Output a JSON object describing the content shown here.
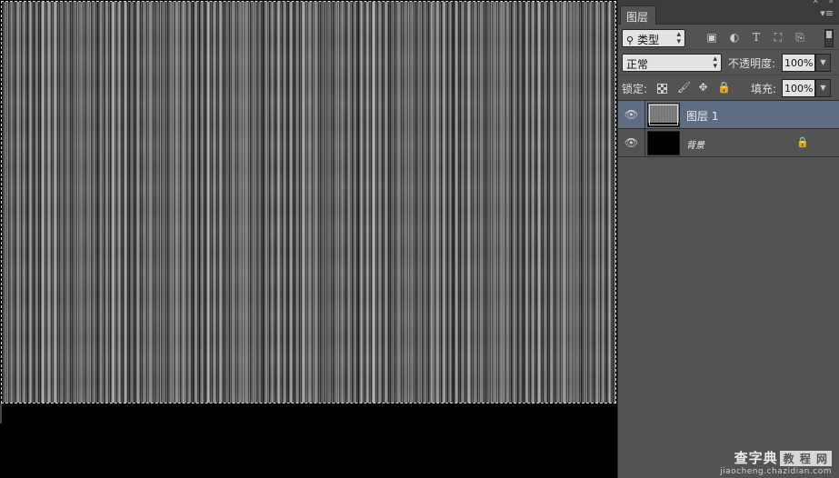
{
  "panel": {
    "tab_label": "图层",
    "filter": {
      "kind_label": "类型"
    },
    "blend": {
      "mode_label": "正常",
      "opacity_label": "不透明度:",
      "opacity_value": "100%"
    },
    "lock": {
      "label": "锁定:",
      "fill_label": "填充:",
      "fill_value": "100%"
    },
    "layers": [
      {
        "name": "图层 1",
        "visible": true,
        "selected": true,
        "locked": false
      },
      {
        "name": "背景",
        "visible": true,
        "selected": false,
        "locked": true
      }
    ]
  },
  "watermark": {
    "brand": "查字典",
    "boxed": "教 程 网",
    "url": "jiaocheng.chazidian.com"
  },
  "colors": {
    "panel_bg": "#535353",
    "selected_layer": "#5f6d83",
    "canvas_bg": "#000000"
  },
  "icons": [
    "eye-icon",
    "lock-icon",
    "search-icon",
    "image-filter-icon",
    "adjustment-filter-icon",
    "type-filter-icon",
    "shape-filter-icon",
    "smart-object-filter-icon",
    "brush-icon",
    "move-icon",
    "panel-menu-icon"
  ]
}
